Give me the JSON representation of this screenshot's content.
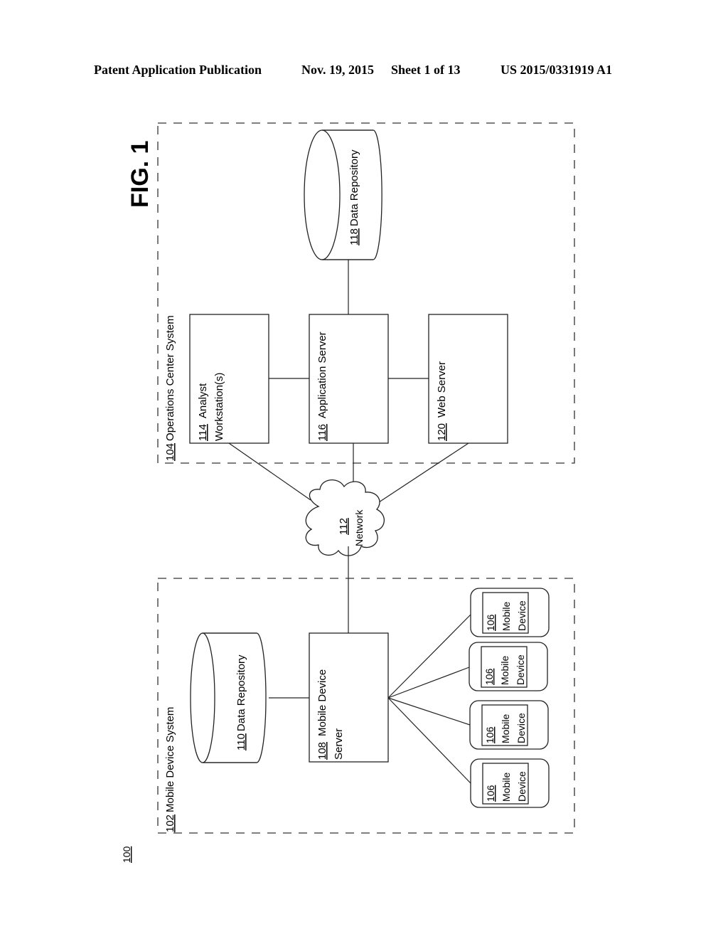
{
  "header": {
    "publication": "Patent Application Publication",
    "date": "Nov. 19, 2015",
    "sheet": "Sheet 1 of 13",
    "number": "US 2015/0331919 A1"
  },
  "figure": {
    "title": "FIG. 1",
    "ref": "100"
  },
  "operations_center": {
    "ref": "104",
    "label": "Operations Center System",
    "analyst": {
      "ref": "114",
      "line1": "Analyst",
      "line2": "Workstation(s)"
    },
    "app_server": {
      "ref": "116",
      "label": "Application Server"
    },
    "web_server": {
      "ref": "120",
      "label": "Web Server"
    },
    "repository": {
      "ref": "118",
      "label": "Data Repository"
    }
  },
  "network": {
    "ref": "112",
    "label": "Network"
  },
  "mobile_system": {
    "ref": "102",
    "label": "Mobile Device System",
    "repository": {
      "ref": "110",
      "label": "Data Repository"
    },
    "server": {
      "ref": "108",
      "line1": "Mobile Device",
      "line2": "Server"
    },
    "devices": [
      {
        "ref": "106",
        "line1": "Mobile",
        "line2": "Device"
      },
      {
        "ref": "106",
        "line1": "Mobile",
        "line2": "Device"
      },
      {
        "ref": "106",
        "line1": "Mobile",
        "line2": "Device"
      },
      {
        "ref": "106",
        "line1": "Mobile",
        "line2": "Device"
      }
    ]
  }
}
